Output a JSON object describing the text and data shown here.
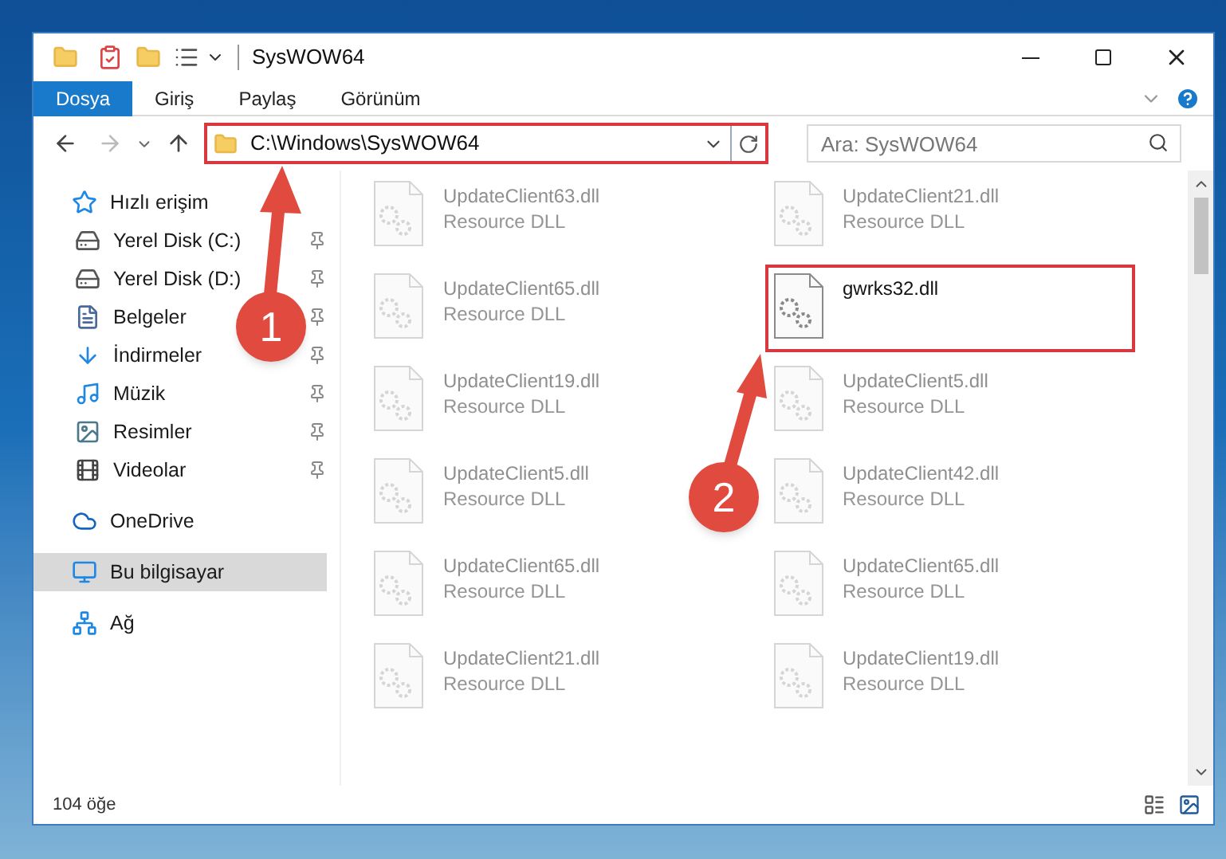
{
  "window": {
    "title": "SysWOW64"
  },
  "ribbon_tabs": [
    {
      "label": "Dosya",
      "kind": "file",
      "selected": false
    },
    {
      "label": "Giriş",
      "kind": "tab",
      "selected": false
    },
    {
      "label": "Paylaş",
      "kind": "tab",
      "selected": false
    },
    {
      "label": "Görünüm",
      "kind": "tab",
      "selected": false
    }
  ],
  "address_bar": {
    "value": "C:\\Windows\\SysWOW64",
    "highlighted": true
  },
  "search": {
    "placeholder": "Ara: SysWOW64"
  },
  "sidebar": {
    "items": [
      {
        "label": "Hızlı erişim",
        "kind": "quick",
        "selected": false,
        "children": [
          {
            "label": "Yerel Disk (C:)",
            "kind": "disk-c",
            "pinned": true,
            "selected": false
          },
          {
            "label": "Yerel Disk (D:)",
            "kind": "disk",
            "pinned": true,
            "selected": false
          },
          {
            "label": "Belgeler",
            "kind": "documents",
            "pinned": true,
            "selected": false
          },
          {
            "label": "İndirmeler",
            "kind": "downloads",
            "pinned": true,
            "selected": false
          },
          {
            "label": "Müzik",
            "kind": "music",
            "pinned": true,
            "selected": false
          },
          {
            "label": "Resimler",
            "kind": "pictures",
            "pinned": true,
            "selected": false
          },
          {
            "label": "Videolar",
            "kind": "videos",
            "pinned": true,
            "selected": false
          }
        ]
      },
      {
        "label": "OneDrive",
        "kind": "cloud",
        "selected": false
      },
      {
        "label": "Bu bilgisayar",
        "kind": "pc",
        "selected": true
      },
      {
        "label": "Ağ",
        "kind": "network",
        "selected": false
      }
    ]
  },
  "files": [
    {
      "name": "UpdateClient63.dll",
      "type": "Resource DLL",
      "faded": true,
      "highlighted": false
    },
    {
      "name": "UpdateClient21.dll",
      "type": "Resource DLL",
      "faded": true,
      "highlighted": false
    },
    {
      "name": "UpdateClient65.dll",
      "type": "Resource DLL",
      "faded": true,
      "highlighted": false
    },
    {
      "name": "gwrks32.dll",
      "faded": false,
      "highlighted": true
    },
    {
      "name": "UpdateClient19.dll",
      "type": "Resource DLL",
      "faded": true,
      "highlighted": false
    },
    {
      "name": "UpdateClient5.dll",
      "type": "Resource DLL",
      "faded": true,
      "highlighted": false
    },
    {
      "name": "UpdateClient5.dll",
      "type": "Resource DLL",
      "faded": true,
      "highlighted": false
    },
    {
      "name": "UpdateClient42.dll",
      "type": "Resource DLL",
      "faded": true,
      "highlighted": false
    },
    {
      "name": "UpdateClient65.dll",
      "type": "Resource DLL",
      "faded": true,
      "highlighted": false
    },
    {
      "name": "UpdateClient65.dll",
      "type": "Resource DLL",
      "faded": true,
      "highlighted": false
    },
    {
      "name": "UpdateClient21.dll",
      "type": "Resource DLL",
      "faded": true,
      "highlighted": false
    },
    {
      "name": "UpdateClient19.dll",
      "type": "Resource DLL",
      "faded": true,
      "highlighted": false
    }
  ],
  "status_bar": {
    "item_count": "104 öğe"
  },
  "annotations": [
    {
      "number": "1"
    },
    {
      "number": "2"
    }
  ]
}
